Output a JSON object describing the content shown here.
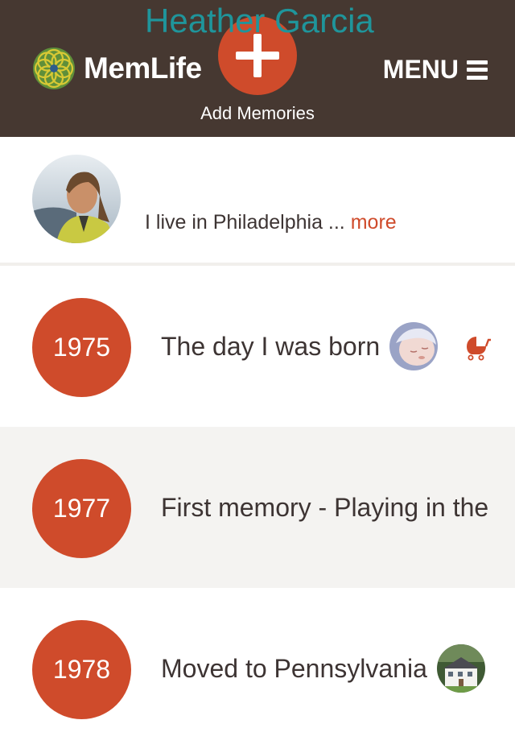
{
  "header": {
    "app_name": "MemLife",
    "add_label": "Add Memories",
    "menu_label": "MENU",
    "brand_color": "#463831",
    "accent_color": "#cf4b2b"
  },
  "profile": {
    "name": "Heather Garcia",
    "bio": "I live in Philadelphia ...",
    "more_label": "more",
    "name_color": "#1f959b"
  },
  "timeline": [
    {
      "year": "1975",
      "title": "The day I was born",
      "thumb_icon": "baby-photo",
      "extra_icon": "stroller-icon"
    },
    {
      "year": "1977",
      "title": "First memory - Playing in the"
    },
    {
      "year": "1978",
      "title": "Moved to Pennsylvania",
      "thumb_icon": "house-photo"
    }
  ]
}
